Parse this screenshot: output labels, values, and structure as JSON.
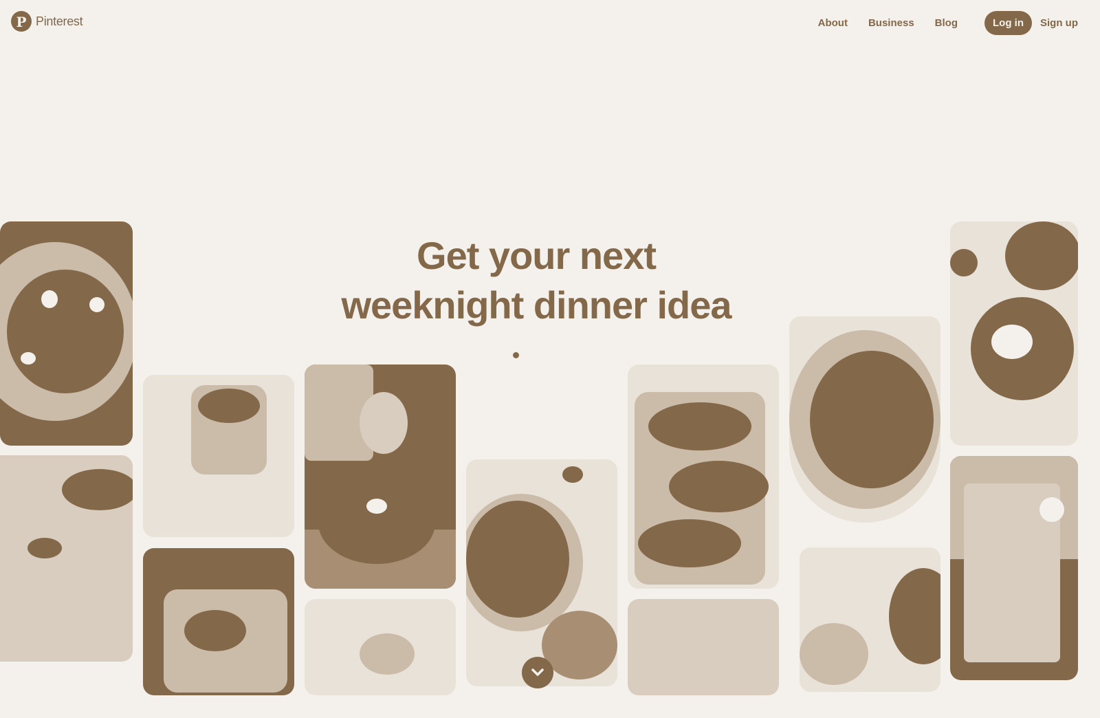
{
  "header": {
    "logo_text": "Pinterest",
    "nav": {
      "about": "About",
      "business": "Business",
      "blog": "Blog",
      "login": "Log in",
      "signup": "Sign up"
    }
  },
  "hero": {
    "headline_line1": "Get your next",
    "headline_line2": "weeknight dinner idea"
  },
  "colors": {
    "accent": "#83684a",
    "background": "#f4f1ec"
  },
  "icons": {
    "logo": "pinterest-logo-icon",
    "scroll": "chevron-down-icon"
  }
}
